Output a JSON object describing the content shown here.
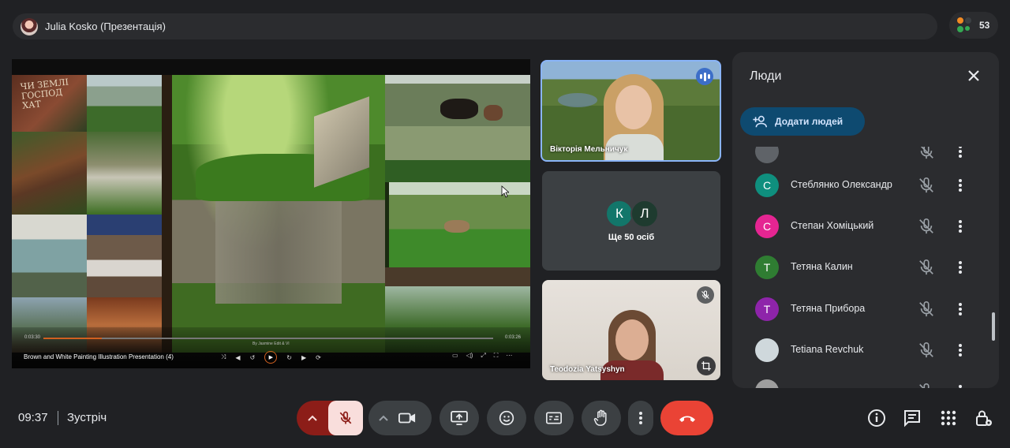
{
  "top_bar": {
    "presenter_title": "Julia Kosko (Презентація)",
    "participant_count": "53"
  },
  "presentation": {
    "video_title": "Brown and White Painting Illustration Presentation (4)",
    "time_elapsed": "0:03:30",
    "time_total": "0:03:26",
    "progress": 0.13,
    "overlay_label": "By Jasmine Edit & VI",
    "slide_text": "ЧИ ЗЕМЛІ ГОСПОД ХАТ"
  },
  "tiles": [
    {
      "name": "Вікторія Мельничук",
      "state": "speaking"
    },
    {
      "label": "Ще 50 осіб",
      "avatars": [
        "К",
        "Л"
      ],
      "avatar_colors": [
        "#12766a",
        "#1e3b2f"
      ]
    },
    {
      "name": "Teodozia Yatsyshyn",
      "state": "muted"
    }
  ],
  "people_panel": {
    "title": "Люди",
    "add_button": "Додати людей",
    "people": [
      {
        "initial": "",
        "name": "",
        "color": "#5f6368"
      },
      {
        "initial": "С",
        "name": "Стеблянко Олександр",
        "color": "#0f8f7e"
      },
      {
        "initial": "С",
        "name": "Степан Хоміцький",
        "color": "#e52592"
      },
      {
        "initial": "Т",
        "name": "Тетяна Калин",
        "color": "#2f7d32"
      },
      {
        "initial": "Т",
        "name": "Тетяна Прибора",
        "color": "#8e24aa"
      },
      {
        "initial": "",
        "name": "Tetiana Revchuk",
        "color": "#cfd8dc"
      },
      {
        "initial": "",
        "name": "",
        "color": "#9e9e9e"
      }
    ]
  },
  "bottom": {
    "time": "09:37",
    "meeting_name": "Зустріч"
  },
  "colors": {
    "accent_blue": "#8ab4f8",
    "hangup_red": "#ea4335",
    "mic_off_bg": "#f9dedc",
    "mic_chevron_bg": "#8c1d18"
  }
}
